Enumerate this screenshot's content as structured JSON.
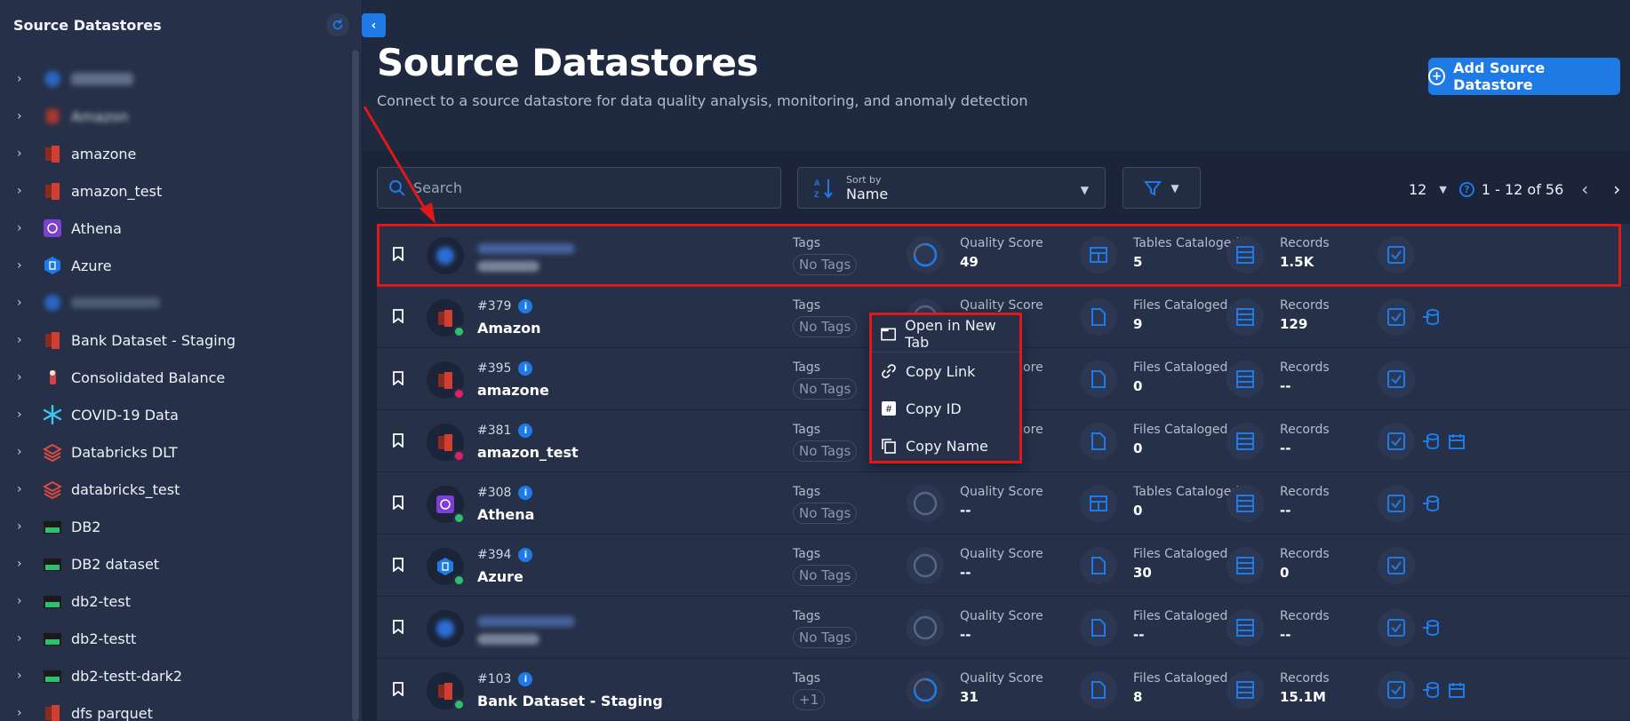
{
  "sidebar": {
    "title": "Source Datastores",
    "items": [
      {
        "label": "",
        "blurred": true
      },
      {
        "label": "Amazon",
        "blurred": true
      },
      {
        "label": "amazone"
      },
      {
        "label": "amazon_test"
      },
      {
        "label": "Athena"
      },
      {
        "label": "Azure"
      },
      {
        "label": "",
        "blurred": true
      },
      {
        "label": "Bank Dataset - Staging"
      },
      {
        "label": "Consolidated Balance"
      },
      {
        "label": "COVID-19 Data"
      },
      {
        "label": "Databricks DLT"
      },
      {
        "label": "databricks_test"
      },
      {
        "label": "DB2"
      },
      {
        "label": "DB2 dataset"
      },
      {
        "label": "db2-test"
      },
      {
        "label": "db2-testt"
      },
      {
        "label": "db2-testt-dark2"
      },
      {
        "label": "dfs parquet"
      }
    ]
  },
  "header": {
    "title": "Source Datastores",
    "subtitle": "Connect to a source datastore for data quality analysis, monitoring, and anomaly detection",
    "add_button": "Add Source Datastore"
  },
  "toolbar": {
    "search_placeholder": "Search",
    "sort_label": "Sort by",
    "sort_value": "Name",
    "page_size": "12",
    "range": "1 - 12 of 56"
  },
  "rows": [
    {
      "id": "",
      "name": "",
      "blurred": true,
      "tags_label": "Tags",
      "tag": "No Tags",
      "status": "",
      "m1_label": "Quality Score",
      "m1_value": "49",
      "m2_label": "Tables Cataloged",
      "m2_value": "5",
      "m3_label": "Records",
      "m3_value": "1.5K"
    },
    {
      "id": "#379",
      "name": "Amazon",
      "tags_label": "Tags",
      "tag": "No Tags",
      "status": "#2ec06a",
      "m1_label": "Quality Score",
      "m1_value": "--",
      "m2_label": "Files Cataloged",
      "m2_value": "9",
      "m3_label": "Records",
      "m3_value": "129"
    },
    {
      "id": "#395",
      "name": "amazone",
      "tags_label": "Tags",
      "tag": "No Tags",
      "status": "#e81e63",
      "m1_label": "Quality Score",
      "m1_value": "--",
      "m2_label": "Files Cataloged",
      "m2_value": "0",
      "m3_label": "Records",
      "m3_value": "--"
    },
    {
      "id": "#381",
      "name": "amazon_test",
      "tags_label": "Tags",
      "tag": "No Tags",
      "status": "#e81e63",
      "m1_label": "Quality Score",
      "m1_value": "--",
      "m2_label": "Files Cataloged",
      "m2_value": "0",
      "m3_label": "Records",
      "m3_value": "--"
    },
    {
      "id": "#308",
      "name": "Athena",
      "tags_label": "Tags",
      "tag": "No Tags",
      "status": "#2ec06a",
      "m1_label": "Quality Score",
      "m1_value": "--",
      "m2_label": "Tables Cataloged",
      "m2_value": "0",
      "m3_label": "Records",
      "m3_value": "--"
    },
    {
      "id": "#394",
      "name": "Azure",
      "tags_label": "Tags",
      "tag": "No Tags",
      "status": "#2ec06a",
      "m1_label": "Quality Score",
      "m1_value": "--",
      "m2_label": "Files Cataloged",
      "m2_value": "30",
      "m3_label": "Records",
      "m3_value": "0"
    },
    {
      "id": "",
      "name": "",
      "blurred": true,
      "tags_label": "Tags",
      "tag": "No Tags",
      "status": "",
      "m1_label": "Quality Score",
      "m1_value": "--",
      "m2_label": "Files Cataloged",
      "m2_value": "--",
      "m3_label": "Records",
      "m3_value": "--"
    },
    {
      "id": "#103",
      "name": "Bank Dataset - Staging",
      "tags_label": "Tags",
      "tag": "+1",
      "status": "#2ec06a",
      "m1_label": "Quality Score",
      "m1_value": "31",
      "m2_label": "Files Cataloged",
      "m2_value": "8",
      "m3_label": "Records",
      "m3_value": "15.1M"
    }
  ],
  "context_menu": {
    "open_new_tab": "Open in New Tab",
    "copy_link": "Copy Link",
    "copy_id": "Copy ID",
    "copy_name": "Copy Name"
  },
  "colors": {
    "accent": "#1e7be6",
    "annotation_red": "#e01818",
    "status_green": "#2ec06a",
    "status_red": "#e81e63"
  }
}
